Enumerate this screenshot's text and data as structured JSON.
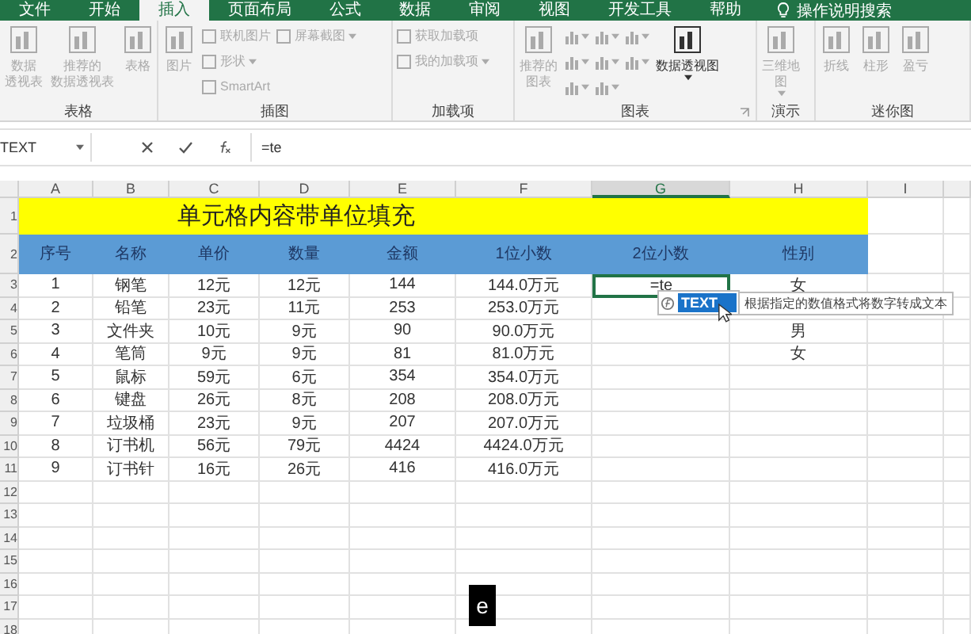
{
  "ribbon_tabs": [
    {
      "label": "文件",
      "selected": false
    },
    {
      "label": "开始",
      "selected": false
    },
    {
      "label": "插入",
      "selected": true
    },
    {
      "label": "页面布局",
      "selected": false
    },
    {
      "label": "公式",
      "selected": false
    },
    {
      "label": "数据",
      "selected": false
    },
    {
      "label": "审阅",
      "selected": false
    },
    {
      "label": "视图",
      "selected": false
    },
    {
      "label": "开发工具",
      "selected": false
    },
    {
      "label": "帮助",
      "selected": false
    }
  ],
  "tell_me": "操作说明搜索",
  "ribbon_groups": [
    {
      "label": "表格",
      "launcher": false,
      "items": [
        {
          "kind": "large",
          "lines": [
            "数据",
            "透视表"
          ],
          "dropdown": false,
          "disabled": true
        },
        {
          "kind": "large",
          "lines": [
            "推荐的",
            "数据透视表"
          ],
          "dropdown": false,
          "disabled": true
        },
        {
          "kind": "large",
          "lines": [
            "表格"
          ],
          "dropdown": false,
          "disabled": true
        }
      ]
    },
    {
      "label": "插图",
      "launcher": false,
      "items": [
        {
          "kind": "large",
          "lines": [
            "图片"
          ],
          "dropdown": false,
          "disabled": true
        },
        {
          "kind": "small",
          "lines": [
            "联机图片"
          ],
          "dropdown": false,
          "disabled": true
        },
        {
          "kind": "small",
          "lines": [
            "形状"
          ],
          "dropdown": true,
          "disabled": true
        },
        {
          "kind": "small",
          "lines": [
            "SmartArt"
          ],
          "dropdown": false,
          "disabled": true
        },
        {
          "kind": "small",
          "lines": [
            "屏幕截图"
          ],
          "dropdown": true,
          "disabled": true
        }
      ]
    },
    {
      "label": "加载项",
      "launcher": false,
      "items": [
        {
          "kind": "small",
          "lines": [
            "获取加载项"
          ],
          "dropdown": false,
          "disabled": true
        },
        {
          "kind": "small",
          "lines": [
            "我的加载项"
          ],
          "dropdown": true,
          "disabled": true
        }
      ]
    },
    {
      "label": "图表",
      "launcher": true,
      "items": [
        {
          "kind": "large",
          "lines": [
            "推荐的",
            "图表"
          ],
          "dropdown": false,
          "disabled": true
        },
        {
          "kind": "icon",
          "dropdown": true,
          "disabled": true
        },
        {
          "kind": "icon",
          "dropdown": true,
          "disabled": true
        },
        {
          "kind": "icon",
          "dropdown": true,
          "disabled": true
        },
        {
          "kind": "icon",
          "dropdown": true,
          "disabled": true
        },
        {
          "kind": "icon",
          "dropdown": true,
          "disabled": true
        },
        {
          "kind": "icon",
          "dropdown": true,
          "disabled": true
        },
        {
          "kind": "icon",
          "dropdown": true,
          "disabled": true
        },
        {
          "kind": "icon",
          "dropdown": true,
          "disabled": true
        },
        {
          "kind": "large",
          "lines": [
            "数据透视图"
          ],
          "dropdown": true,
          "disabled": false
        }
      ]
    },
    {
      "label": "演示",
      "launcher": false,
      "items": [
        {
          "kind": "large",
          "lines": [
            "三维地",
            "图"
          ],
          "dropdown": true,
          "disabled": true
        }
      ]
    },
    {
      "label": "迷你图",
      "launcher": false,
      "items": [
        {
          "kind": "large",
          "lines": [
            "折线"
          ],
          "dropdown": false,
          "disabled": true
        },
        {
          "kind": "large",
          "lines": [
            "柱形"
          ],
          "dropdown": false,
          "disabled": true
        },
        {
          "kind": "large",
          "lines": [
            "盈亏"
          ],
          "dropdown": false,
          "disabled": true
        }
      ]
    }
  ],
  "name_box": "TEXT",
  "formula": "=te",
  "columns": [
    {
      "label": "A",
      "selected": false
    },
    {
      "label": "B",
      "selected": false
    },
    {
      "label": "C",
      "selected": false
    },
    {
      "label": "D",
      "selected": false
    },
    {
      "label": "E",
      "selected": false
    },
    {
      "label": "F",
      "selected": false
    },
    {
      "label": "G",
      "selected": true
    },
    {
      "label": "H",
      "selected": false
    },
    {
      "label": "I",
      "selected": false
    }
  ],
  "row_numbers": [
    "1",
    "2",
    "3",
    "4",
    "5",
    "6",
    "7",
    "8",
    "9",
    "10",
    "11",
    "12",
    "13",
    "14",
    "15",
    "16",
    "17",
    "18"
  ],
  "title": "单元格内容带单位填充",
  "headers": [
    "序号",
    "名称",
    "单价",
    "数量",
    "金额",
    "1位小数",
    "2位小数",
    "性别"
  ],
  "rows": [
    {
      "cells": [
        "1",
        "钢笔",
        "12元",
        "12元",
        "144",
        "144.0万元"
      ],
      "editing": "=te",
      "gender": "女"
    },
    {
      "cells": [
        "2",
        "铅笔",
        "23元",
        "11元",
        "253",
        "253.0万元"
      ]
    },
    {
      "cells": [
        "3",
        "文件夹",
        "10元",
        "9元",
        "90",
        "90.0万元"
      ],
      "gender": "男"
    },
    {
      "cells": [
        "4",
        "笔筒",
        "9元",
        "9元",
        "81",
        "81.0万元"
      ],
      "gender": "女"
    },
    {
      "cells": [
        "5",
        "鼠标",
        "59元",
        "6元",
        "354",
        "354.0万元"
      ]
    },
    {
      "cells": [
        "6",
        "键盘",
        "26元",
        "8元",
        "208",
        "208.0万元"
      ]
    },
    {
      "cells": [
        "7",
        "垃圾桶",
        "23元",
        "9元",
        "207",
        "207.0万元"
      ]
    },
    {
      "cells": [
        "8",
        "订书机",
        "56元",
        "79元",
        "4424",
        "4424.0万元"
      ]
    },
    {
      "cells": [
        "9",
        "订书针",
        "16元",
        "26元",
        "416",
        "416.0万元"
      ]
    }
  ],
  "autocomplete": {
    "item": "TEXT",
    "tooltip": "根据指定的数值格式将数字转成文本"
  },
  "keystroke": "e"
}
